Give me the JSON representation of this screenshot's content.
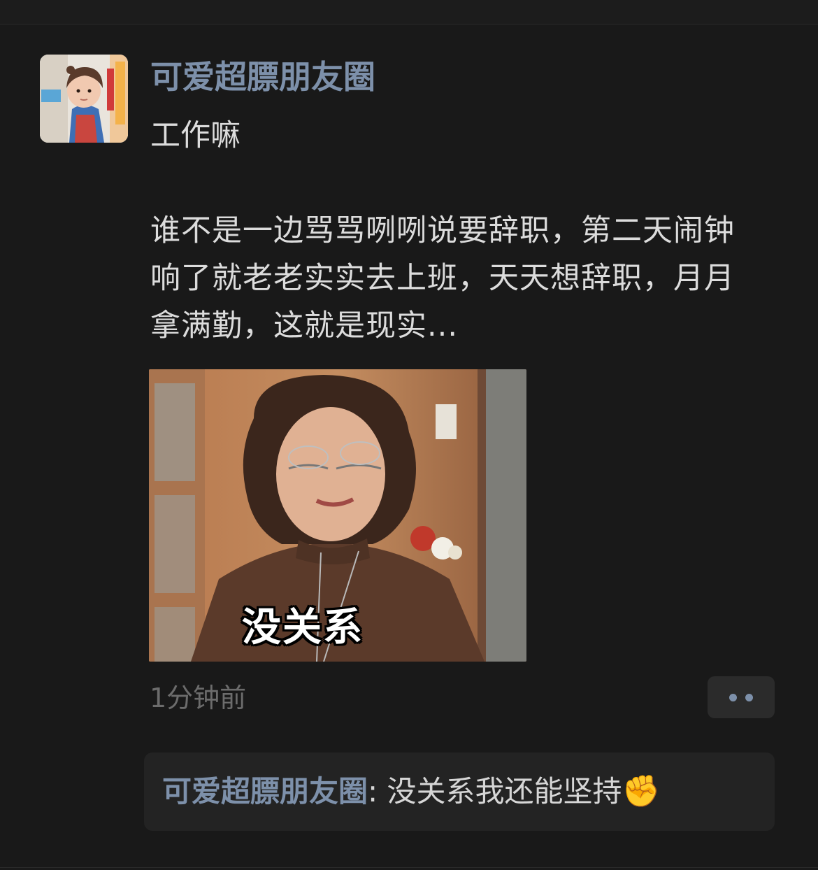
{
  "post": {
    "author": "可爱超膘朋友圈",
    "text_line1": "工作嘛",
    "text_line2": "谁不是一边骂骂咧咧说要辞职，第二天闹钟响了就老老实实去上班，天天想辞职，月月拿满勤，这就是现实...",
    "image_caption": "没关系",
    "time": "1分钟前"
  },
  "comment": {
    "author": "可爱超膘朋友圈",
    "separator": ": ",
    "text": "没关系我还能坚持",
    "emoji": "✊"
  },
  "icons": {
    "more": "more-dots-icon",
    "emoji": "raised-fist-icon"
  },
  "colors": {
    "background": "#191919",
    "link_name": "#7d90aa",
    "text": "#dcdcdc",
    "muted": "#6c6c6c",
    "comment_bg": "#232323"
  }
}
